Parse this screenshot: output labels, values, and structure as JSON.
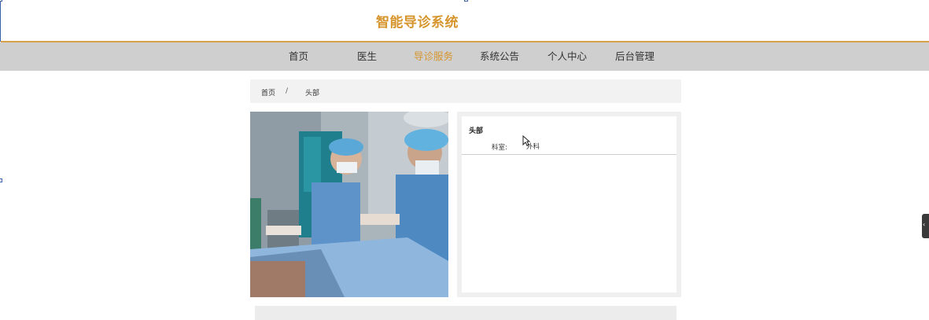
{
  "app": {
    "title": "智能导诊系统"
  },
  "nav": {
    "items": [
      {
        "label": "首页",
        "active": false
      },
      {
        "label": "医生",
        "active": false
      },
      {
        "label": "导诊服务",
        "active": true
      },
      {
        "label": "系统公告",
        "active": false
      },
      {
        "label": "个人中心",
        "active": false
      },
      {
        "label": "后台管理",
        "active": false
      }
    ]
  },
  "breadcrumb": {
    "home": "首页",
    "separator": "/",
    "current": "头部"
  },
  "detail": {
    "title": "头部",
    "department_label": "科室:",
    "department_value": "外科"
  },
  "colors": {
    "accent": "#d6952c",
    "nav_bg": "#cfcfcf",
    "panel_bg": "#f0f0f0"
  },
  "icons": {
    "side_tab": "chevron-left-icon",
    "cursor": "mouse-pointer-icon"
  }
}
